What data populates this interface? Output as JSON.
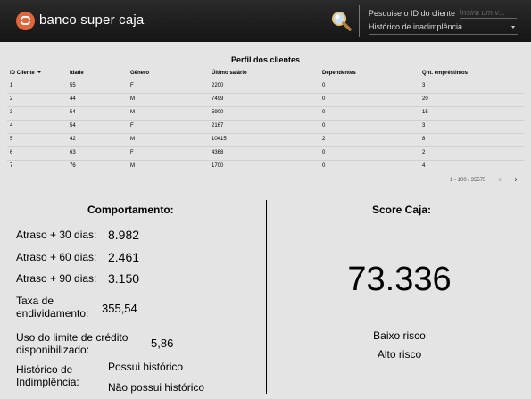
{
  "header": {
    "brand": "banco super caja",
    "search_label": "Pesquise o ID do cliente",
    "search_placeholder": "Insira um v...",
    "select_value": "Histórico de inadimplência",
    "brand_color": "#e2663c"
  },
  "table": {
    "title": "Perfil dos clientes",
    "columns": [
      "ID Cliente",
      "Idade",
      "Gênero",
      "Último salário",
      "Dependentes",
      "Qnt. empréstimos"
    ],
    "rows": [
      [
        "1",
        "55",
        "F",
        "2200",
        "0",
        "3"
      ],
      [
        "2",
        "44",
        "M",
        "7499",
        "0",
        "20"
      ],
      [
        "3",
        "54",
        "M",
        "5900",
        "0",
        "15"
      ],
      [
        "4",
        "54",
        "F",
        "2167",
        "0",
        "3"
      ],
      [
        "5",
        "42",
        "M",
        "10415",
        "2",
        "8"
      ],
      [
        "6",
        "63",
        "F",
        "4368",
        "0",
        "2"
      ],
      [
        "7",
        "76",
        "M",
        "1700",
        "0",
        "4"
      ]
    ],
    "pagination": "1 - 100 / 35575"
  },
  "comportamento": {
    "title": "Comportamento:",
    "atraso30_label": "Atraso + 30 dias:",
    "atraso30_value": "8.982",
    "atraso60_label": "Atraso + 60 dias:",
    "atraso60_value": "2.461",
    "atraso90_label": "Atraso + 90 dias:",
    "atraso90_value": "3.150",
    "taxa_label_1": "Taxa de",
    "taxa_label_2": "endividamento:",
    "taxa_value": "355,54",
    "uso_label_1": "Uso do limite de crédito",
    "uso_label_2": "disponibilizado:",
    "uso_value": "5,86",
    "hist_label_1": "Histórico de",
    "hist_label_2": "Indimplência:",
    "hist_value_1": "Possui histórico",
    "hist_value_2": "Não possui histórico"
  },
  "score": {
    "title": "Score Caja:",
    "value": "73.336",
    "low_risk": "Baixo risco",
    "high_risk": "Alto risco"
  }
}
